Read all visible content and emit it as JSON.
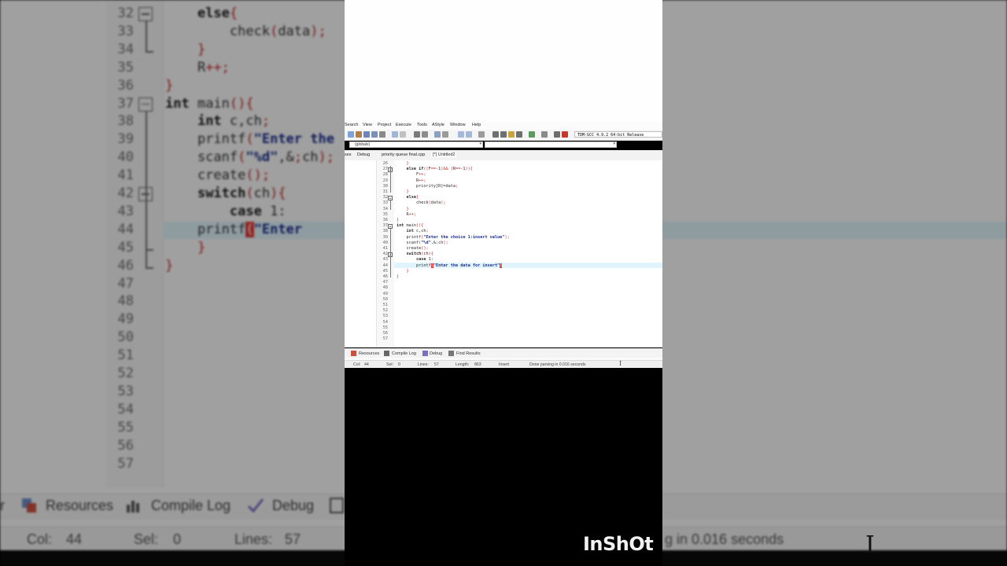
{
  "watermark": "InShOt",
  "menu": [
    "Search",
    "View",
    "Project",
    "Execute",
    "Tools",
    "AStyle",
    "Window",
    "Help"
  ],
  "toolbar": {
    "compiler": "TDM-GCC 4.9.2 64-bit Release"
  },
  "scope": {
    "value": "(globals)",
    "second": ""
  },
  "sidetabs": [
    "ses",
    "Debug"
  ],
  "tabs": [
    "priority queue final.cpp",
    "[*] Untitled2"
  ],
  "editor": {
    "lines": [
      {
        "n": "26",
        "t": "    }"
      },
      {
        "n": "27",
        "t": "    else if((F==-1)&& (R==-1)){"
      },
      {
        "n": "28",
        "t": "        F++;"
      },
      {
        "n": "29",
        "t": "        R++;"
      },
      {
        "n": "30",
        "t": "        priority[R]=data;"
      },
      {
        "n": "31",
        "t": "    }"
      },
      {
        "n": "32",
        "t": "    else{"
      },
      {
        "n": "33",
        "t": "        check(data);"
      },
      {
        "n": "34",
        "t": "    }"
      },
      {
        "n": "35",
        "t": "    R++;"
      },
      {
        "n": "36",
        "t": "}"
      },
      {
        "n": "37",
        "t": "int main(){"
      },
      {
        "n": "38",
        "t": "    int c,ch;"
      },
      {
        "n": "39",
        "t": "    printf(\"Enter the choice 1:insert value\");"
      },
      {
        "n": "40",
        "t": "    scanf(\"%d\",&ch);"
      },
      {
        "n": "41",
        "t": "    create();"
      },
      {
        "n": "42",
        "t": "    switch(ch){"
      },
      {
        "n": "43",
        "t": "        case 1:"
      },
      {
        "n": "44",
        "t": "        printf(\"Enter the data for insert\")"
      },
      {
        "n": "45",
        "t": "    }"
      },
      {
        "n": "46",
        "t": "}"
      },
      {
        "n": "47",
        "t": ""
      },
      {
        "n": "48",
        "t": ""
      },
      {
        "n": "49",
        "t": ""
      },
      {
        "n": "50",
        "t": ""
      },
      {
        "n": "51",
        "t": ""
      },
      {
        "n": "52",
        "t": ""
      },
      {
        "n": "53",
        "t": ""
      },
      {
        "n": "54",
        "t": ""
      },
      {
        "n": "55",
        "t": ""
      },
      {
        "n": "56",
        "t": ""
      },
      {
        "n": "57",
        "t": ""
      }
    ]
  },
  "bottom_tabs": [
    "Resources",
    "Compile Log",
    "Debug",
    "Find Results"
  ],
  "status": {
    "col_label": "Col:",
    "col": "44",
    "sel_label": "Sel:",
    "sel": "0",
    "lines_label": "Lines:",
    "lines": "57",
    "length_label": "Length:",
    "length": "863",
    "mode": "Insert",
    "message": "Done parsing in 0.016 seconds"
  },
  "background": {
    "lines": [
      {
        "n": "32",
        "t": "    else{"
      },
      {
        "n": "33",
        "t": "        check(data);"
      },
      {
        "n": "34",
        "t": "    }"
      },
      {
        "n": "35",
        "t": "    R++;"
      },
      {
        "n": "36",
        "t": "}"
      },
      {
        "n": "37",
        "t": "int main(){"
      },
      {
        "n": "38",
        "t": "    int c,ch;"
      },
      {
        "n": "39",
        "t": "    printf(\"Enter the"
      },
      {
        "n": "40",
        "t": "    scanf(\"%d\",&ch);"
      },
      {
        "n": "41",
        "t": "    create();"
      },
      {
        "n": "42",
        "t": "    switch(ch){"
      },
      {
        "n": "43",
        "t": "        case 1:"
      },
      {
        "n": "44",
        "t": "        printf(\"Enter"
      },
      {
        "n": "45",
        "t": "    }"
      },
      {
        "n": "46",
        "t": "}"
      },
      {
        "n": "47",
        "t": ""
      },
      {
        "n": "48",
        "t": ""
      },
      {
        "n": "49",
        "t": ""
      },
      {
        "n": "50",
        "t": ""
      },
      {
        "n": "51",
        "t": ""
      },
      {
        "n": "52",
        "t": ""
      },
      {
        "n": "53",
        "t": ""
      },
      {
        "n": "54",
        "t": ""
      },
      {
        "n": "55",
        "t": ""
      },
      {
        "n": "56",
        "t": ""
      },
      {
        "n": "57",
        "t": ""
      }
    ],
    "tabs": [
      "Resources",
      "Compile Log",
      "Debug"
    ],
    "tab_prefix": "r",
    "status_col_label": "Col:",
    "status_col": "44",
    "status_sel_label": "Sel:",
    "status_sel": "0",
    "status_lines_label": "Lines:",
    "status_lines": "57",
    "status_msg": "g in 0.016 seconds"
  },
  "colors": {
    "accent": "#c62828",
    "string": "#1d2f8f",
    "highlight": "#dff4fb"
  }
}
